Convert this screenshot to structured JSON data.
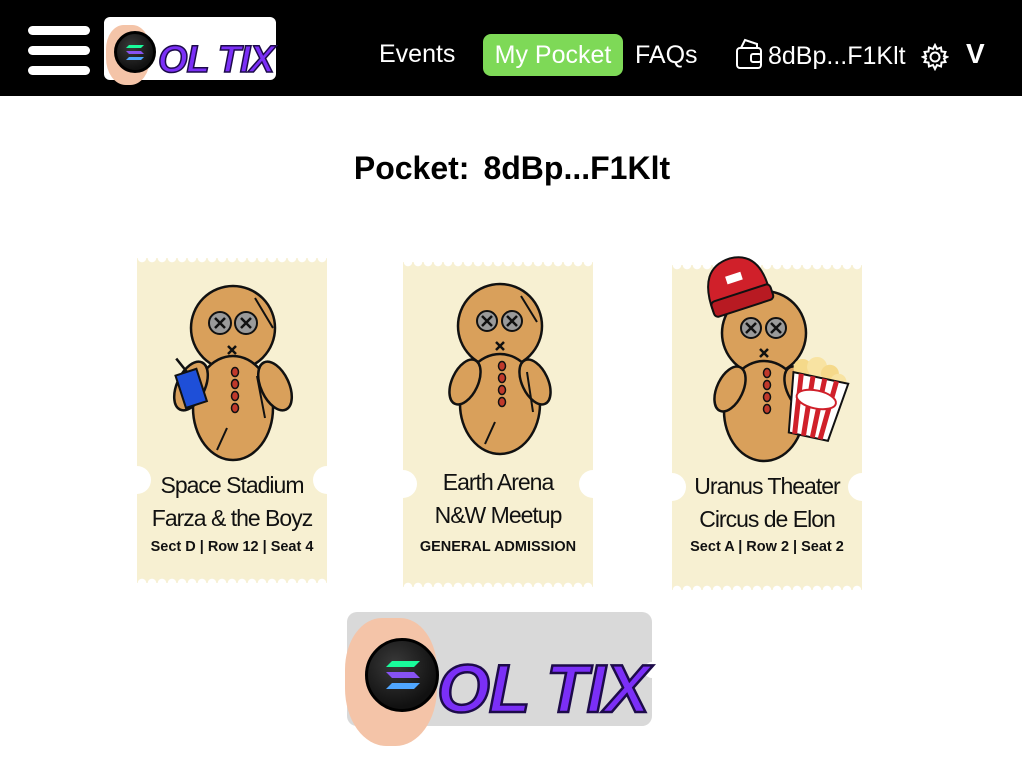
{
  "nav": {
    "links": {
      "events": "Events",
      "pocket": "My Pocket",
      "faqs": "FAQs"
    },
    "wallet_address": "8dBp...F1Klt",
    "dropdown_glyph": "V",
    "logo": "SOL TIX"
  },
  "pocket": {
    "label": "Pocket:",
    "address": "8dBp...F1Klt"
  },
  "tickets": [
    {
      "venue": "Space Stadium",
      "event": "Farza & the  Boyz",
      "seat": "Sect D | Row 12 | Seat 4",
      "prop": "drink"
    },
    {
      "venue": "Earth Arena",
      "event": "N&W Meetup",
      "seat": "GENERAL ADMISSION",
      "prop": "none"
    },
    {
      "venue": "Uranus Theater",
      "event": "Circus de Elon",
      "seat": "Sect A | Row 2 | Seat 2",
      "prop": "popcorn",
      "popcorn_label": "POPCORN"
    }
  ],
  "footer": {
    "logo": "SOL TIX"
  },
  "colors": {
    "nav_bg": "#000000",
    "active_tab": "#7ed957",
    "ticket_bg": "#f7f0d2",
    "brand_purple": "#7b2ff7",
    "doll": "#d9a05b"
  }
}
